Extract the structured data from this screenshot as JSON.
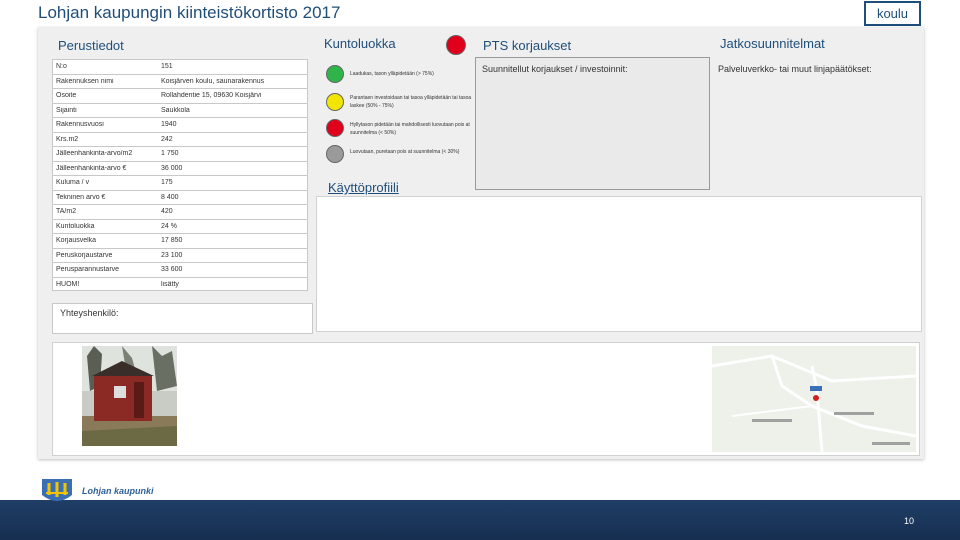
{
  "title": "Lohjan kaupungin kiinteistökortisto 2017",
  "tag_button": "koulu",
  "sections": {
    "perustiedot": "Perustiedot",
    "kuntoluokka": "Kuntoluokka",
    "pts": "PTS korjaukset",
    "jatko": "Jatkosuunnitelmat",
    "kayttoprofiili": "Käyttöprofiili"
  },
  "basic_info": [
    {
      "key": "N:o",
      "value": "151"
    },
    {
      "key": "Rakennuksen nimi",
      "value": "Koisjärven koulu, saunarakennus"
    },
    {
      "key": "Osoite",
      "value": "Rollahdentie 15, 09630 Koisjärvi"
    },
    {
      "key": "Sijainti",
      "value": "Saukkola"
    },
    {
      "key": "Rakennusvuosi",
      "value": "1940"
    },
    {
      "key": "Krs.m2",
      "value": "242"
    },
    {
      "key": "Jälleenhankinta-arvo/m2",
      "value": "1 750"
    },
    {
      "key": "Jälleenhankinta-arvo €",
      "value": "36 000"
    },
    {
      "key": "Kuluma / v",
      "value": "175"
    },
    {
      "key": "Tekninen arvo €",
      "value": "8 400"
    },
    {
      "key": "TA/m2",
      "value": "420"
    },
    {
      "key": "Kuntoluokka",
      "value": "24 %"
    },
    {
      "key": "Korjausvelka",
      "value": "17 850"
    },
    {
      "key": "Peruskorjaustarve",
      "value": "23 100"
    },
    {
      "key": "Perusparannustarve",
      "value": "33 600"
    },
    {
      "key": "HUOM!",
      "value": "lisätty"
    }
  ],
  "condition_indicator_color": "#e0001b",
  "condition_legend": [
    {
      "color": "#2fb44a",
      "text": "Laadukas, tason ylläpidetään (> 75%)"
    },
    {
      "color": "#f2e500",
      "text": "Parantaen investoidaan tai tasoa ylläpidetään tai tasoa laskee (50% - 75%)"
    },
    {
      "color": "#e0001b",
      "text": "Hyllytason pidetään tai mahdollisesti luovutaan pois at suunnitelma (< 50%)"
    },
    {
      "color": "#9a9a9a",
      "text": "Luovutaan, puretaan pois at suunnitelma (< 30%)"
    }
  ],
  "pts_text": "Suunnitellut korjaukset / investoinnit:",
  "jatko_text": "Palveluverkko- tai muut linjapäätökset:",
  "contact_label": "Yhteyshenkilö:",
  "footer_org": "Lohjan kaupunki",
  "page_number": "10"
}
